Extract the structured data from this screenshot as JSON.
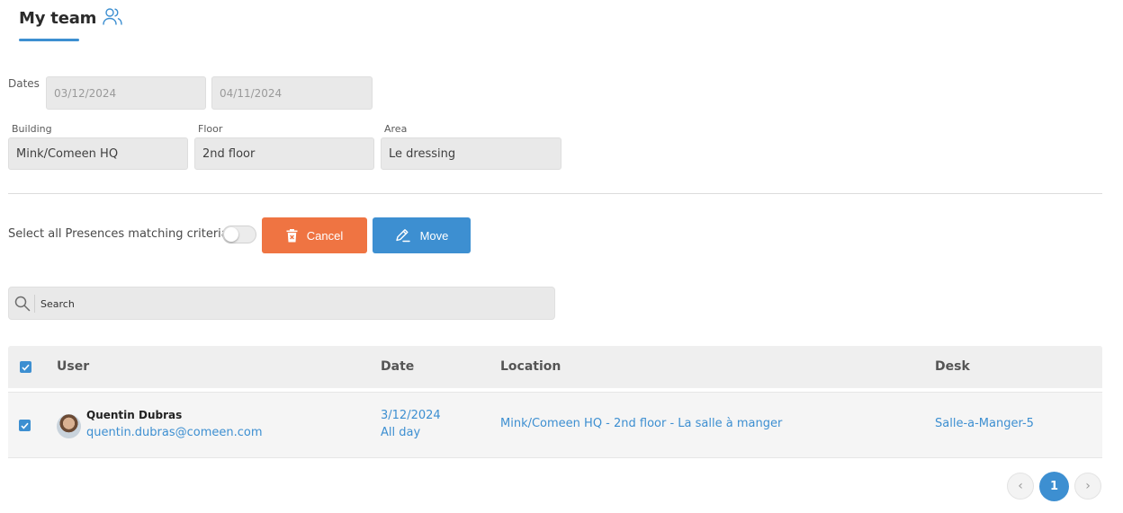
{
  "header": {
    "title": "My team",
    "icon": "team-icon"
  },
  "filters": {
    "dates_label": "Dates",
    "start_date": "03/12/2024",
    "end_date": "04/11/2024",
    "building_label": "Building",
    "building_value": "Mink/Comeen HQ",
    "floor_label": "Floor",
    "floor_value": "2nd floor",
    "area_label": "Area",
    "area_value": "Le dressing"
  },
  "actions": {
    "select_all_label": "Select all Presences matching criteria",
    "select_all_on": false,
    "cancel_label": "Cancel",
    "move_label": "Move"
  },
  "search": {
    "placeholder": "Search"
  },
  "table": {
    "columns": [
      "User",
      "Date",
      "Location",
      "Desk"
    ],
    "header_checked": true,
    "rows": [
      {
        "checked": true,
        "name": "Quentin Dubras",
        "email": "quentin.dubras@comeen.com",
        "date": "3/12/2024",
        "duration": "All day",
        "location": "Mink/Comeen HQ - 2nd floor - La salle à manger",
        "desk": "Salle-a-Manger-5"
      }
    ]
  },
  "pagination": {
    "prev": "‹",
    "current": "1",
    "next": "›"
  },
  "colors": {
    "accent": "#3d8fd1",
    "cancel": "#ef7442"
  }
}
